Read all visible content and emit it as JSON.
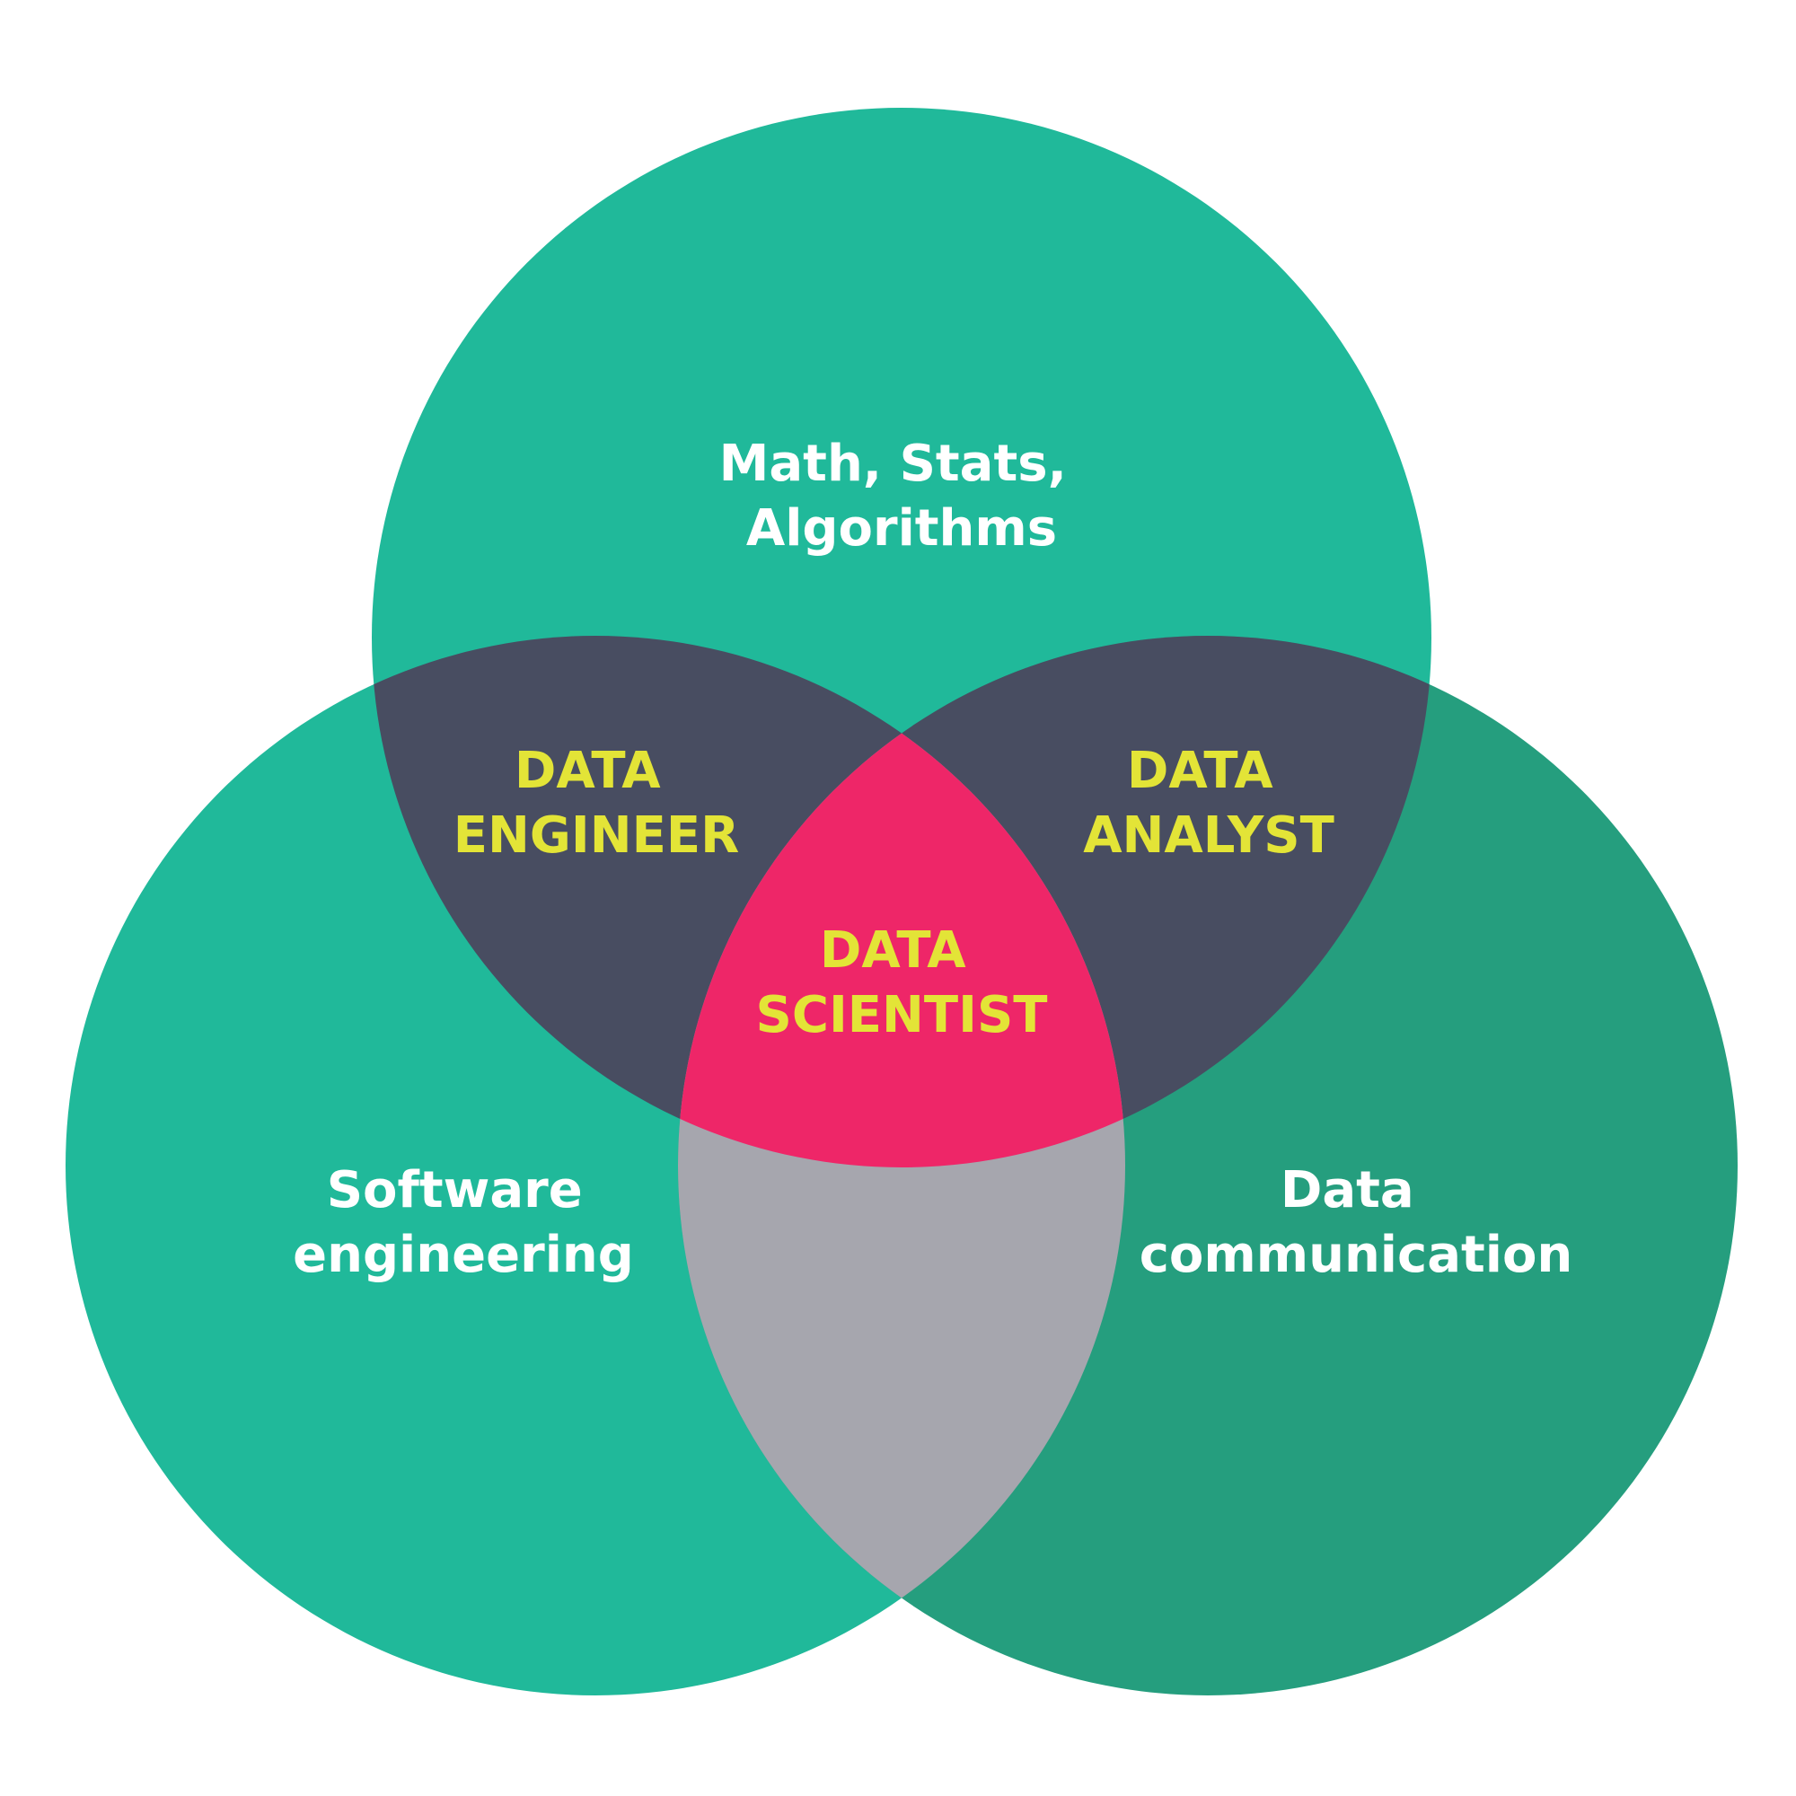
{
  "colors": {
    "circle_top": "#20b99a",
    "circle_left": "#20b99a",
    "circle_right": "#259e7e",
    "overlap_top_left": "#484d61",
    "overlap_top_right": "#484d61",
    "overlap_left_right": "#a6a6ae",
    "overlap_center": "#ee2668",
    "label_outer": "#ffffff",
    "label_inner": "#e3e437",
    "background": "#ffffff"
  },
  "circles": {
    "top": {
      "line1": "Math, Stats,",
      "line2": "Algorithms"
    },
    "left": {
      "line1": "Software",
      "line2": "engineering"
    },
    "right": {
      "line1": "Data",
      "line2": "communication"
    }
  },
  "overlaps": {
    "top_left": {
      "line1": "DATA",
      "line2": "ENGINEER"
    },
    "top_right": {
      "line1": "DATA",
      "line2": "ANALYST"
    },
    "center": {
      "line1": "DATA",
      "line2": "SCIENTIST"
    }
  }
}
